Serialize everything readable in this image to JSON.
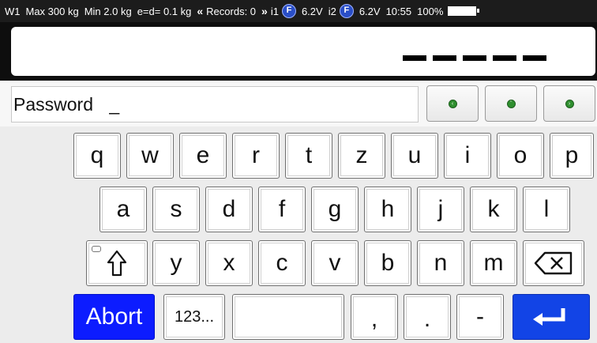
{
  "status_bar": {
    "scale_id": "W1",
    "max": "Max 300 kg",
    "min": "Min 2.0 kg",
    "division": "e=d= 0.1 kg",
    "records": "Records: 0",
    "input1_label": "i1",
    "input1_voltage": "6.2V",
    "input2_label": "i2",
    "input2_voltage": "6.2V",
    "time": "10:55",
    "battery": "100%"
  },
  "display": {
    "weight_placeholder": "-----"
  },
  "input": {
    "label": "Password",
    "cursor": "_"
  },
  "keyboard": {
    "row1": [
      "q",
      "w",
      "e",
      "r",
      "t",
      "z",
      "u",
      "i",
      "o",
      "p"
    ],
    "row2": [
      "a",
      "s",
      "d",
      "f",
      "g",
      "h",
      "j",
      "k",
      "l"
    ],
    "row3": [
      "y",
      "x",
      "c",
      "v",
      "b",
      "n",
      "m"
    ],
    "abort_label": "Abort",
    "numeric_label": "123...",
    "comma_label": ",",
    "period_label": ".",
    "dash_label": "-"
  },
  "icons": {
    "fuel": "fuel-icon",
    "battery": "battery-icon",
    "shift": "shift-icon",
    "backspace": "backspace-icon",
    "enter": "enter-icon",
    "nav": "green-dot-icon"
  },
  "colors": {
    "abort": "#0c1cff",
    "enter": "#1244e6",
    "status_bar": "#1c1c1c",
    "nav_dot": "#2f8f2f"
  }
}
